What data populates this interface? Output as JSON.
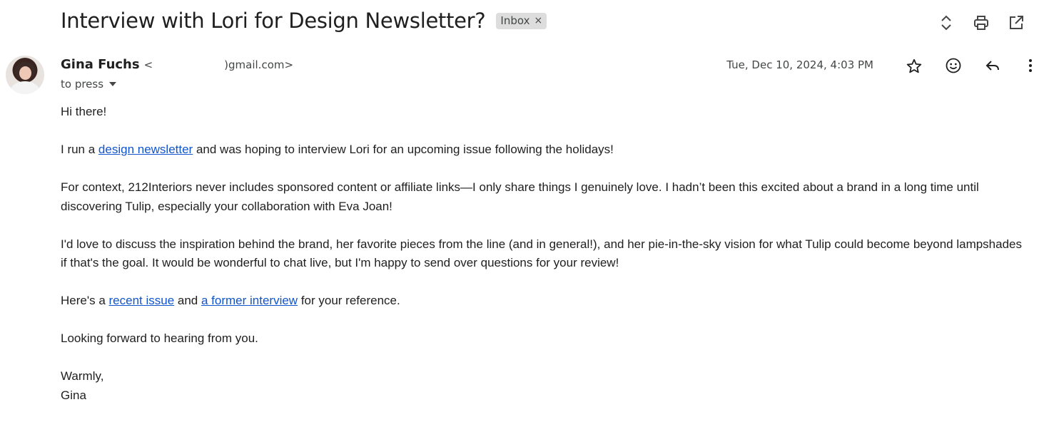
{
  "subject": "Interview with Lori for Design Newsletter?",
  "label": {
    "name": "Inbox",
    "remove_glyph": "×"
  },
  "sender": {
    "name": "Gina Fuchs",
    "email_prefix": "<",
    "email_suffix": ")gmail.com>"
  },
  "recipient": "to press",
  "date": "Tue, Dec 10, 2024, 4:03 PM",
  "icons": {
    "top": [
      "expand-collapse-icon",
      "print-icon",
      "open-new-window-icon"
    ],
    "message": [
      "star-icon",
      "emoji-reaction-icon",
      "reply-icon",
      "more-vert-icon"
    ]
  },
  "body": {
    "greeting": "Hi there!",
    "p1_before": "I run a ",
    "p1_link": "design newsletter",
    "p1_after": " and was hoping to interview Lori for an upcoming issue following the holidays!",
    "p2": "For context, 212Interiors never includes sponsored content or affiliate links—I only share things I genuinely love. I hadn’t been this excited about a brand in a long time until discovering Tulip, especially your collaboration with Eva Joan!",
    "p3": "I'd love to discuss the inspiration behind the brand, her favorite pieces from the line (and in general!), and her pie-in-the-sky vision for what Tulip could become beyond lampshades if that's the goal. It would be wonderful to chat live, but I'm happy to send over questions for your review!",
    "p4_before": "Here's a ",
    "p4_link1": "recent issue",
    "p4_mid": " and ",
    "p4_link2": "a former interview",
    "p4_after": " for your reference.",
    "p5": "Looking forward to hearing from you.",
    "signoff": "Warmly,",
    "signature": "Gina"
  },
  "colors": {
    "link": "#1155cc",
    "text": "#1f1f1f",
    "muted": "#444746",
    "chip": "#dddddd"
  }
}
